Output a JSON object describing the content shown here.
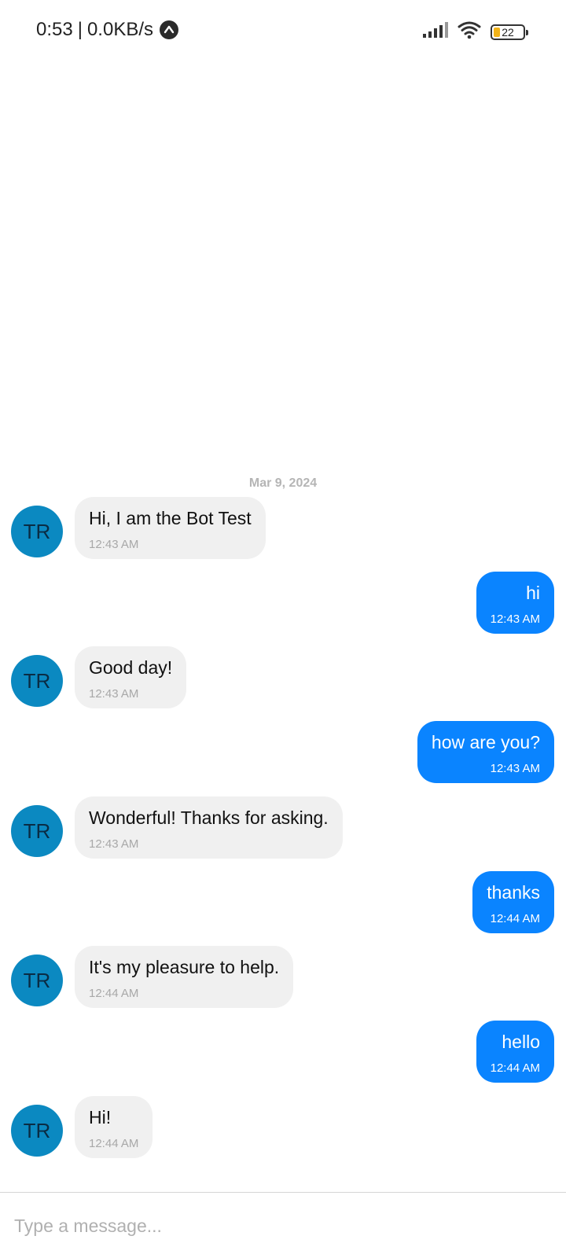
{
  "status_bar": {
    "time": "0:53",
    "separator": "|",
    "network_speed": "0.0KB/s",
    "upload_icon": "upload-arrow-icon",
    "signal_icon": "signal-bars-icon",
    "wifi_icon": "wifi-icon",
    "battery_level": "22",
    "battery_fill_fraction": 0.22,
    "battery_accent": "#f2b319"
  },
  "chat": {
    "date_separator": "Mar 9, 2024",
    "avatar_initials": "TR",
    "avatar_color": "#0b89c1",
    "incoming_bubble_color": "#f0f0f0",
    "outgoing_bubble_color": "#0a84ff",
    "messages": [
      {
        "direction": "in",
        "text": "Hi, I am the Bot Test",
        "time": "12:43 AM"
      },
      {
        "direction": "out",
        "text": "hi",
        "time": "12:43 AM"
      },
      {
        "direction": "in",
        "text": "Good day!",
        "time": "12:43 AM"
      },
      {
        "direction": "out",
        "text": "how are you?",
        "time": "12:43 AM"
      },
      {
        "direction": "in",
        "text": "Wonderful! Thanks for asking.",
        "time": "12:43 AM"
      },
      {
        "direction": "out",
        "text": "thanks",
        "time": "12:44 AM"
      },
      {
        "direction": "in",
        "text": "It's my pleasure to help.",
        "time": "12:44 AM"
      },
      {
        "direction": "out",
        "text": "hello",
        "time": "12:44 AM"
      },
      {
        "direction": "in",
        "text": "Hi!",
        "time": "12:44 AM"
      }
    ]
  },
  "composer": {
    "placeholder": "Type a message...",
    "value": ""
  }
}
